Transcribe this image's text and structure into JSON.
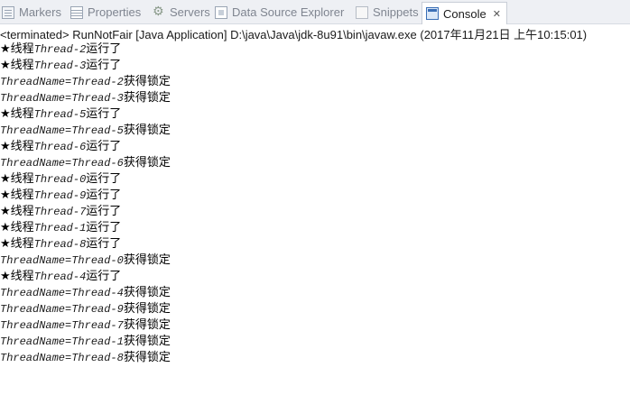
{
  "tabs": [
    {
      "label": "Markers",
      "icon": "markers-icon"
    },
    {
      "label": "Properties",
      "icon": "properties-icon"
    },
    {
      "label": "Servers",
      "icon": "servers-icon"
    },
    {
      "label": "Data Source Explorer",
      "icon": "data-source-explorer-icon"
    },
    {
      "label": "Snippets",
      "icon": "snippets-icon"
    },
    {
      "label": "Console",
      "icon": "console-icon",
      "close": "✕"
    }
  ],
  "status": "<terminated> RunNotFair [Java Application] D:\\java\\Java\\jdk-8u91\\bin\\javaw.exe (2017年11月21日 上午10:15:01)",
  "console_lines": [
    {
      "prefix": "★线程",
      "italic": "Thread-2",
      "suffix": "运行了"
    },
    {
      "prefix": "★线程",
      "italic": "Thread-3",
      "suffix": "运行了"
    },
    {
      "prefix": "",
      "italic": "ThreadName=Thread-2",
      "suffix": "获得锁定"
    },
    {
      "prefix": "",
      "italic": "ThreadName=Thread-3",
      "suffix": "获得锁定"
    },
    {
      "prefix": "★线程",
      "italic": "Thread-5",
      "suffix": "运行了"
    },
    {
      "prefix": "",
      "italic": "ThreadName=Thread-5",
      "suffix": "获得锁定"
    },
    {
      "prefix": "★线程",
      "italic": "Thread-6",
      "suffix": "运行了"
    },
    {
      "prefix": "",
      "italic": "ThreadName=Thread-6",
      "suffix": "获得锁定"
    },
    {
      "prefix": "★线程",
      "italic": "Thread-0",
      "suffix": "运行了"
    },
    {
      "prefix": "★线程",
      "italic": "Thread-9",
      "suffix": "运行了"
    },
    {
      "prefix": "★线程",
      "italic": "Thread-7",
      "suffix": "运行了"
    },
    {
      "prefix": "★线程",
      "italic": "Thread-1",
      "suffix": "运行了"
    },
    {
      "prefix": "★线程",
      "italic": "Thread-8",
      "suffix": "运行了"
    },
    {
      "prefix": "",
      "italic": "ThreadName=Thread-0",
      "suffix": "获得锁定"
    },
    {
      "prefix": "★线程",
      "italic": "Thread-4",
      "suffix": "运行了"
    },
    {
      "prefix": "",
      "italic": "ThreadName=Thread-4",
      "suffix": "获得锁定"
    },
    {
      "prefix": "",
      "italic": "ThreadName=Thread-9",
      "suffix": "获得锁定"
    },
    {
      "prefix": "",
      "italic": "ThreadName=Thread-7",
      "suffix": "获得锁定"
    },
    {
      "prefix": "",
      "italic": "ThreadName=Thread-1",
      "suffix": "获得锁定"
    },
    {
      "prefix": "",
      "italic": "ThreadName=Thread-8",
      "suffix": "获得锁定"
    }
  ]
}
